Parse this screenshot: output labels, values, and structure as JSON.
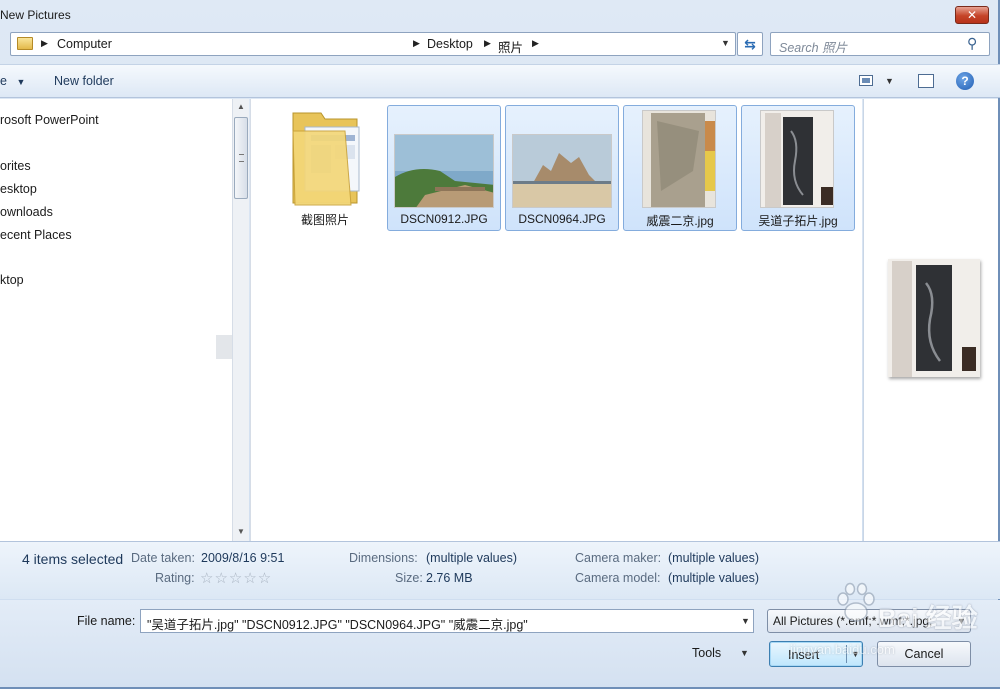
{
  "window": {
    "title": "New Pictures"
  },
  "address": {
    "crumbs": [
      "Computer",
      "Desktop",
      "照片"
    ]
  },
  "search": {
    "placeholder": "Search 照片"
  },
  "toolbar": {
    "organize_label": "e",
    "new_folder_label": "New folder"
  },
  "nav": {
    "items": [
      "rosoft PowerPoint",
      "orites",
      "esktop",
      "ownloads",
      "ecent Places",
      "ktop"
    ]
  },
  "files": [
    {
      "name": "截图照片",
      "kind": "folder",
      "selected": false
    },
    {
      "name": "DSCN0912.JPG",
      "kind": "image",
      "selected": true
    },
    {
      "name": "DSCN0964.JPG",
      "kind": "image",
      "selected": true
    },
    {
      "name": "威震二京.jpg",
      "kind": "image",
      "selected": true
    },
    {
      "name": "吴道子拓片.jpg",
      "kind": "image",
      "selected": true
    }
  ],
  "details": {
    "count": "4 items selected",
    "date_taken_label": "Date taken:",
    "date_taken": "2009/8/16 9:51",
    "rating_label": "Rating:",
    "rating": 0,
    "dimensions_label": "Dimensions:",
    "dimensions": "(multiple values)",
    "size_label": "Size:",
    "size": "2.76 MB",
    "camera_maker_label": "Camera maker:",
    "camera_maker": "(multiple values)",
    "camera_model_label": "Camera model:",
    "camera_model": "(multiple values)"
  },
  "footer": {
    "file_name_label": "File name:",
    "file_name_value": "\"吴道子拓片.jpg\" \"DSCN0912.JPG\" \"DSCN0964.JPG\" \"威震二京.jpg\"",
    "filter_value": "All Pictures (*.emf;*.wmf;*.jpg;",
    "tools_label": "Tools",
    "insert_label": "Insert",
    "cancel_label": "Cancel"
  },
  "watermark": {
    "text": "Bai 经验",
    "sub": "jingyan.baidu.com"
  }
}
